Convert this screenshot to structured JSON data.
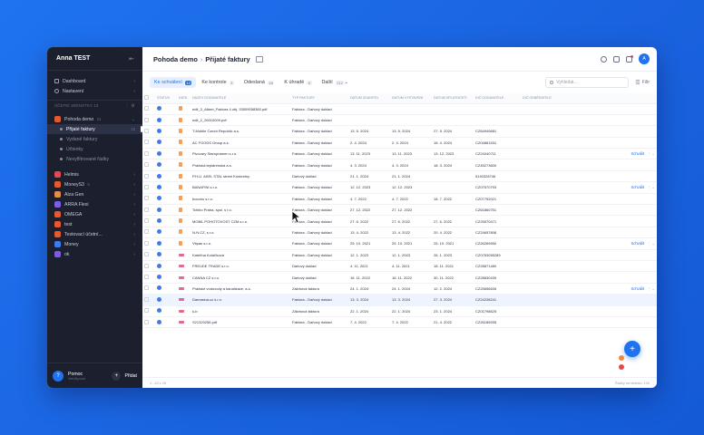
{
  "sidebar": {
    "account_name": "Anna TEST",
    "nav": [
      {
        "label": "Dashboard"
      },
      {
        "label": "Nastavení"
      }
    ],
    "section_label": "ÚČETNÍ JEDNOTKY",
    "section_count": "13",
    "orgs": [
      {
        "label": "Pohoda demo",
        "count": "21",
        "color": "#e8572d",
        "expanded": true
      },
      {
        "label": "Helmis",
        "count": "",
        "color": "#e5484d"
      },
      {
        "label": "MoneyS3",
        "count": "5",
        "color": "#e8572d"
      },
      {
        "label": "Alza Gen",
        "count": "",
        "color": "#f08a3c"
      },
      {
        "label": "ARRA Flexi",
        "count": "",
        "color": "#7c5ce6"
      },
      {
        "label": "OMEGA",
        "count": "",
        "color": "#e8572d"
      },
      {
        "label": "test",
        "count": "",
        "color": "#e8572d"
      },
      {
        "label": "Testovací účetní...",
        "count": "",
        "color": "#e8572d"
      },
      {
        "label": "Money",
        "count": "",
        "color": "#3d7bf0"
      },
      {
        "label": "ok",
        "count": "",
        "color": "#7c5ce6"
      }
    ],
    "sub_items": [
      {
        "label": "Přijaté faktury",
        "count": "23",
        "active": true
      },
      {
        "label": "Vydané faktury",
        "count": "",
        "active": false
      },
      {
        "label": "Účtenky",
        "count": "",
        "active": false
      },
      {
        "label": "Nevyfiltrované řádky",
        "count": "",
        "active": false
      }
    ],
    "help_title": "Pomoc",
    "help_sub": "Vendly.com",
    "add_label": "Přidat"
  },
  "topbar": {
    "breadcrumb_parent": "Pohoda demo",
    "breadcrumb_current": "Přijaté faktury",
    "avatar": "A"
  },
  "filters": {
    "tabs": [
      {
        "label": "Ke schválení",
        "badge": "12",
        "active": true
      },
      {
        "label": "Ke kontrole",
        "badge": "3",
        "active": false
      },
      {
        "label": "Odeslaná",
        "badge": "48",
        "active": false
      },
      {
        "label": "K úhradě",
        "badge": "6",
        "active": false
      },
      {
        "label": "Další",
        "badge": "212",
        "active": false
      }
    ],
    "search_placeholder": "Vyhledat...",
    "filter_label": "Filtr"
  },
  "table": {
    "columns": [
      "STATUS",
      "DATA",
      "NÁZEV DODAVATELE",
      "TYP FAKTURY",
      "DATUM ZDANITEL",
      "DATUM VYSTAVENÍ",
      "DATUM SPLATNOSTI",
      "DIČ DODAVATELE",
      "DIČ ODBĚRATELE"
    ],
    "rows": [
      {
        "doc": "file",
        "name": "edit_3_Albert_Faktura 4 obj. 33009058360.pdf",
        "type": "Faktura - Daňový doklad",
        "d1": "",
        "d2": "",
        "d3": "",
        "dic": "",
        "action": "",
        "hl": false
      },
      {
        "doc": "file",
        "name": "edit_2_26010009.pdf",
        "type": "Faktura - Daňový doklad",
        "d1": "",
        "d2": "",
        "d3": "",
        "dic": "",
        "action": "",
        "hl": false
      },
      {
        "doc": "file",
        "name": "T-Mobile Czech Republic a.s.",
        "type": "Faktura - Daňový doklad",
        "d1": "13. 5. 2024",
        "d2": "13. 5. 2024",
        "d3": "27. 5. 2024",
        "dic": "CZ64949681",
        "action": "",
        "hl": false
      },
      {
        "doc": "file",
        "name": "AC FOODS Group a.s.",
        "type": "Faktura - Daňový doklad",
        "d1": "2. 4. 2024",
        "d2": "2. 4. 2024",
        "d3": "16. 4. 2024",
        "dic": "CZ04861531",
        "action": "",
        "hl": false
      },
      {
        "doc": "file",
        "name": "Pivovary Staropramen s.r.o.",
        "type": "Faktura - Daňový doklad",
        "d1": "13. 11. 2023",
        "d2": "13. 11. 2023",
        "d3": "13. 12. 2023",
        "dic": "CZ24040711",
        "action": "Schválit",
        "hl": false
      },
      {
        "doc": "file",
        "name": "Pražská teplárenská a.s.",
        "type": "Faktura - Daňový doklad",
        "d1": "4. 3. 2024",
        "d2": "4. 3. 2024",
        "d3": "18. 3. 2024",
        "dic": "CZ45273600",
        "action": "",
        "hl": false
      },
      {
        "doc": "file",
        "name": "P.H.U. AKEL STAL street Konkretny",
        "type": "Daňový doklad",
        "d1": "21. 1. 2024",
        "d2": "21. 1. 2024",
        "d3": "",
        "dic": "5140328746",
        "action": "",
        "hl": false
      },
      {
        "doc": "file",
        "name": "BANAFINI s.r.o.",
        "type": "Faktura - Daňový doklad",
        "d1": "12. 12. 2023",
        "d2": "12. 12. 2023",
        "d3": "",
        "dic": "CZ07570793",
        "action": "Schválit",
        "hl": false
      },
      {
        "doc": "file",
        "name": "bocorio s.r.o.",
        "type": "Faktura - Daňový doklad",
        "d1": "4. 7. 2022",
        "d2": "4. 7. 2022",
        "d3": "18. 7. 2022",
        "dic": "CZ07752021",
        "action": "",
        "hl": false
      },
      {
        "doc": "file",
        "name": "Tchibo Praha, spol. s r.o.",
        "type": "Faktura - Daňový doklad",
        "d1": "27. 12. 2022",
        "d2": "27. 12. 2022",
        "d3": "",
        "dic": "CZ61860751",
        "action": "",
        "hl": false
      },
      {
        "doc": "file",
        "name": "MOBIL POHOTOVOST CZM s.r.o.",
        "type": "Faktura - Daňový doklad",
        "d1": "27. 6. 2022",
        "d2": "27. 6. 2022",
        "d3": "27. 6. 2022",
        "dic": "CZ25570471",
        "action": "",
        "hl": false
      },
      {
        "doc": "file",
        "name": "N-N.CZ, s.r.o.",
        "type": "Faktura - Daňový doklad",
        "d1": "13. 4. 2022",
        "d2": "13. 4. 2022",
        "d3": "20. 4. 2022",
        "dic": "CZ24657808",
        "action": "",
        "hl": false
      },
      {
        "doc": "file",
        "name": "Vitpan s.r.o.",
        "type": "Faktura - Daňový doklad",
        "d1": "25. 10. 2021",
        "d2": "25. 10. 2021",
        "d3": "25. 10. 2021",
        "dic": "CZ26269550",
        "action": "Schválit",
        "hl": false
      },
      {
        "doc": "pdf",
        "name": "Kateřina Kolaříková",
        "type": "Faktura - Daňový doklad",
        "d1": "12. 1. 2023",
        "d2": "12. 1. 2023",
        "d3": "26. 1. 2023",
        "dic": "CZ0753055289",
        "action": "",
        "hl": false
      },
      {
        "doc": "pdf",
        "name": "FREUDE TRADE s.r.o.",
        "type": "Daňový doklad",
        "d1": "4. 11. 2021",
        "d2": "4. 11. 2021",
        "d3": "18. 11. 2021",
        "dic": "CZ28871480",
        "action": "",
        "hl": false
      },
      {
        "doc": "pdf",
        "name": "CANNA CZ s.r.o.",
        "type": "Daňový doklad",
        "d1": "16. 11. 2022",
        "d2": "16. 11. 2022",
        "d3": "30. 11. 2022",
        "dic": "CZ28830439",
        "action": "",
        "hl": false
      },
      {
        "doc": "pdf",
        "name": "Pražské vodovody a kanalizace, a.s.",
        "type": "Zálohová faktura",
        "d1": "24. 1. 2024",
        "d2": "24. 1. 2024",
        "d3": "12. 2. 2024",
        "dic": "CZ25656635",
        "action": "Schválit",
        "hl": false
      },
      {
        "doc": "pdf",
        "name": "Damasina.cz s.r.o.",
        "type": "Faktura - Daňový doklad",
        "d1": "13. 3. 2024",
        "d2": "13. 3. 2024",
        "d3": "27. 3. 2024",
        "dic": "CZ24238241",
        "action": "",
        "hl": true
      },
      {
        "doc": "pdf",
        "name": "k-b",
        "type": "Zálohová faktura",
        "d1": "22. 1. 2024",
        "d2": "22. 1. 2024",
        "d3": "23. 1. 2024",
        "dic": "CZ01798625",
        "action": "",
        "hl": false
      },
      {
        "doc": "pdf",
        "name": "S21320256.pdf",
        "type": "Faktura - Daňový doklad",
        "d1": "7. 4. 2022",
        "d2": "7. 4. 2022",
        "d3": "21. 4. 2022",
        "dic": "CZ26185935",
        "action": "",
        "hl": false
      }
    ],
    "footer_left": "1 - 43 z 25",
    "footer_right": "Řádky na stránku: 100"
  }
}
